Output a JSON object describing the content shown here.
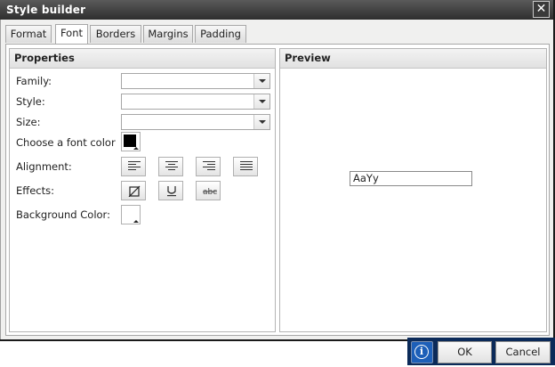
{
  "dialog": {
    "title": "Style builder",
    "close_label": "✕"
  },
  "tabs": [
    {
      "label": "Format",
      "active": false
    },
    {
      "label": "Font",
      "active": true
    },
    {
      "label": "Borders",
      "active": false
    },
    {
      "label": "Margins",
      "active": false
    },
    {
      "label": "Padding",
      "active": false
    }
  ],
  "properties": {
    "title": "Properties",
    "family_label": "Family:",
    "family_value": "",
    "style_label": "Style:",
    "style_value": "",
    "size_label": "Size:",
    "size_value": "",
    "font_color_label": "Choose a font color",
    "font_color": "#000000",
    "alignment_label": "Alignment:",
    "alignment_buttons": [
      "align-left",
      "align-center",
      "align-right",
      "align-justify"
    ],
    "effects_label": "Effects:",
    "effects_buttons": [
      "none",
      "underline",
      "strikethrough"
    ],
    "background_color_label": "Background Color:",
    "background_color": "#ffffff"
  },
  "preview": {
    "title": "Preview",
    "sample_text": "AaYy"
  },
  "footer": {
    "info_glyph": "i",
    "ok_label": "OK",
    "cancel_label": "Cancel"
  }
}
